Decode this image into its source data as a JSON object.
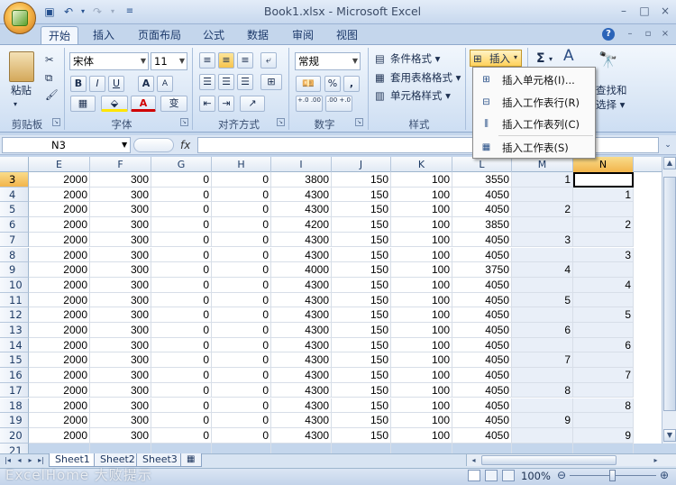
{
  "window": {
    "title": "Book1.xlsx - Microsoft Excel",
    "controls": [
      "–",
      "□",
      "×"
    ]
  },
  "tabs": [
    "开始",
    "插入",
    "页面布局",
    "公式",
    "数据",
    "审阅",
    "视图"
  ],
  "ribbon": {
    "clipboard": {
      "label": "剪贴板",
      "paste": "粘贴"
    },
    "font": {
      "label": "字体",
      "family": "宋体",
      "size": "11",
      "bold": "B",
      "italic": "I",
      "underline": "U",
      "grow": "A",
      "shrink": "A",
      "color_a": "A",
      "wen": "变"
    },
    "alignment": {
      "label": "对齐方式"
    },
    "number": {
      "label": "数字",
      "format": "常规",
      "percent": "%",
      "comma": ",",
      "inc": "+.0 .00",
      "dec": ".00 +.0"
    },
    "styles": {
      "label": "样式",
      "conditional": "条件格式",
      "table_format": "套用表格格式",
      "cell_style": "单元格样式"
    },
    "cells": {
      "insert": "插入"
    },
    "editing": {
      "sigma": "Σ",
      "find": "查找和",
      "select": "选择"
    }
  },
  "insert_menu": [
    {
      "label": "插入单元格(I)..."
    },
    {
      "label": "插入工作表行(R)"
    },
    {
      "label": "插入工作表列(C)"
    },
    {
      "label": "插入工作表(S)"
    }
  ],
  "formula_bar": {
    "name_box": "N3",
    "fx": "fx",
    "formula": ""
  },
  "columns": [
    "E",
    "F",
    "G",
    "H",
    "I",
    "J",
    "K",
    "L",
    "M",
    "N"
  ],
  "rows": [
    {
      "n": "3",
      "cells": [
        "2000",
        "300",
        "0",
        "0",
        "3800",
        "150",
        "100",
        "3550",
        "1",
        ""
      ]
    },
    {
      "n": "4",
      "cells": [
        "2000",
        "300",
        "0",
        "0",
        "4300",
        "150",
        "100",
        "4050",
        "",
        "1"
      ]
    },
    {
      "n": "5",
      "cells": [
        "2000",
        "300",
        "0",
        "0",
        "4300",
        "150",
        "100",
        "4050",
        "2",
        ""
      ]
    },
    {
      "n": "6",
      "cells": [
        "2000",
        "300",
        "0",
        "0",
        "4200",
        "150",
        "100",
        "3850",
        "",
        "2"
      ]
    },
    {
      "n": "7",
      "cells": [
        "2000",
        "300",
        "0",
        "0",
        "4300",
        "150",
        "100",
        "4050",
        "3",
        ""
      ]
    },
    {
      "n": "8",
      "cells": [
        "2000",
        "300",
        "0",
        "0",
        "4300",
        "150",
        "100",
        "4050",
        "",
        "3"
      ]
    },
    {
      "n": "9",
      "cells": [
        "2000",
        "300",
        "0",
        "0",
        "4000",
        "150",
        "100",
        "3750",
        "4",
        ""
      ]
    },
    {
      "n": "10",
      "cells": [
        "2000",
        "300",
        "0",
        "0",
        "4300",
        "150",
        "100",
        "4050",
        "",
        "4"
      ]
    },
    {
      "n": "11",
      "cells": [
        "2000",
        "300",
        "0",
        "0",
        "4300",
        "150",
        "100",
        "4050",
        "5",
        ""
      ]
    },
    {
      "n": "12",
      "cells": [
        "2000",
        "300",
        "0",
        "0",
        "4300",
        "150",
        "100",
        "4050",
        "",
        "5"
      ]
    },
    {
      "n": "13",
      "cells": [
        "2000",
        "300",
        "0",
        "0",
        "4300",
        "150",
        "100",
        "4050",
        "6",
        ""
      ]
    },
    {
      "n": "14",
      "cells": [
        "2000",
        "300",
        "0",
        "0",
        "4300",
        "150",
        "100",
        "4050",
        "",
        "6"
      ]
    },
    {
      "n": "15",
      "cells": [
        "2000",
        "300",
        "0",
        "0",
        "4300",
        "150",
        "100",
        "4050",
        "7",
        ""
      ]
    },
    {
      "n": "16",
      "cells": [
        "2000",
        "300",
        "0",
        "0",
        "4300",
        "150",
        "100",
        "4050",
        "",
        "7"
      ]
    },
    {
      "n": "17",
      "cells": [
        "2000",
        "300",
        "0",
        "0",
        "4300",
        "150",
        "100",
        "4050",
        "8",
        ""
      ]
    },
    {
      "n": "18",
      "cells": [
        "2000",
        "300",
        "0",
        "0",
        "4300",
        "150",
        "100",
        "4050",
        "",
        "8"
      ]
    },
    {
      "n": "19",
      "cells": [
        "2000",
        "300",
        "0",
        "0",
        "4300",
        "150",
        "100",
        "4050",
        "9",
        ""
      ]
    },
    {
      "n": "20",
      "cells": [
        "2000",
        "300",
        "0",
        "0",
        "4300",
        "150",
        "100",
        "4050",
        "",
        "9"
      ]
    },
    {
      "n": "21",
      "cells": [
        "",
        "",
        "",
        "",
        "",
        "",
        "",
        "",
        "",
        ""
      ]
    }
  ],
  "sheets": [
    "Sheet1",
    "Sheet2",
    "Sheet3"
  ],
  "status": {
    "watermark": "ExcelHome 大败提示",
    "zoom": "100%"
  },
  "colors": {
    "accent": "#f2b44b",
    "ribbon_bg": "#dce8f6",
    "title_text": "#3b4b66"
  }
}
